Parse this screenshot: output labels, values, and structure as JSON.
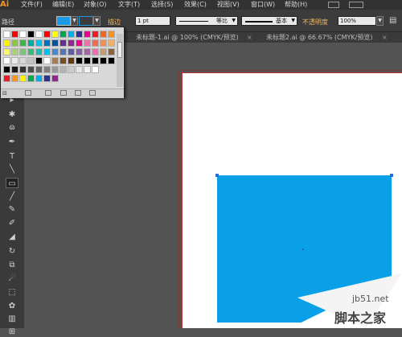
{
  "app": {
    "logo": "Ai"
  },
  "menu": [
    {
      "label": "文件(F)"
    },
    {
      "label": "编辑(E)"
    },
    {
      "label": "对象(O)"
    },
    {
      "label": "文字(T)"
    },
    {
      "label": "选择(S)"
    },
    {
      "label": "效果(C)"
    },
    {
      "label": "视图(V)"
    },
    {
      "label": "窗口(W)"
    },
    {
      "label": "帮助(H)"
    }
  ],
  "control": {
    "path_label": "路径",
    "fill_color": "#1c9ae6",
    "stroke_label": "描边",
    "stroke_weight": "1 pt",
    "profile_label": "等比",
    "brush_label": "基本",
    "opacity_label": "不透明度",
    "opacity_value": "100%"
  },
  "tabs": [
    {
      "label": "未标题-1.ai @ 100% (CMYK/预览)"
    },
    {
      "label": "未标题2.ai @ 66.67% (CMYK/预览)"
    }
  ],
  "tools": [
    "selection-tool",
    "magic-wand-tool",
    "lasso-tool",
    "pen-tool",
    "type-tool",
    "line-tool",
    "rectangle-tool",
    "paintbrush-tool",
    "pencil-tool",
    "blob-brush-tool",
    "eraser-tool",
    "rotate-tool",
    "scale-tool",
    "warp-tool",
    "free-transform-tool",
    "symbol-sprayer-tool",
    "graph-tool",
    "mesh-tool"
  ],
  "swatches": {
    "row1": [
      "#ffffff",
      "#ff0000",
      "#ffffff",
      "#000000",
      "#ffffff",
      "#ff0000",
      "#ffff00",
      "#00a651",
      "#00aeef",
      "#2e3192",
      "#ec008c",
      "#ed1c24",
      "#f26522",
      "#f7941d"
    ],
    "row2": [
      "#fff200",
      "#8dc63f",
      "#39b54a",
      "#00a99d",
      "#00bff3",
      "#0072bc",
      "#0054a6",
      "#662d91",
      "#92278f",
      "#ec008c",
      "#f06eaa",
      "#f26c4f",
      "#f68e56",
      "#fbaf5d"
    ],
    "row3": [
      "#fff568",
      "#acd373",
      "#7cc576",
      "#3cb878",
      "#1cbbb4",
      "#00bff3",
      "#438ccb",
      "#5574b9",
      "#605ca8",
      "#855fa8",
      "#a763a8",
      "#f06eaa",
      "#c69c6d",
      "#8c6239"
    ],
    "row4": [
      "#ffffff",
      "#ebebeb",
      "#d7d7d7",
      "#c2c2c2",
      "#000000",
      "#ffffff",
      "#a67c52",
      "#754c24",
      "#603913",
      "#000000",
      "#000000",
      "#000000",
      "#000000",
      "#000000"
    ],
    "row5": [
      "#000000",
      "#1a1a1a",
      "#333333",
      "#4d4d4d",
      "#666666",
      "#808080",
      "#999999",
      "#b3b3b3",
      "#cccccc",
      "#e6e6e6",
      "#f2f2f2",
      "#ffffff"
    ],
    "row6": [
      "#ed1c24",
      "#f7941d",
      "#fff200",
      "#00a651",
      "#00aeef",
      "#2e3192",
      "#92278f"
    ]
  },
  "watermark": {
    "site": "jb51.net",
    "name": "脚本之家"
  }
}
